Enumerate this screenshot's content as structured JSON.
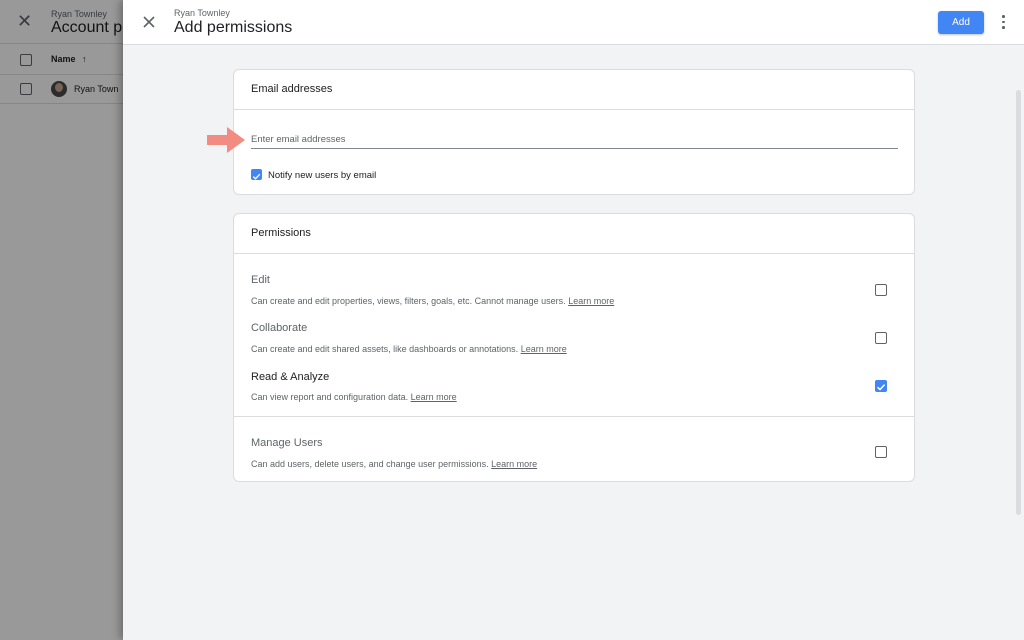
{
  "background_page": {
    "account_name": "Ryan Townley",
    "title": "Account p",
    "column_name": "Name",
    "sort_icon": "arrow-up-icon",
    "row_user": "Ryan Town"
  },
  "dialog": {
    "account_name": "Ryan Townley",
    "title": "Add permissions",
    "add_label": "Add",
    "colors": {
      "accent": "#4285f4",
      "panel_bg": "#f1f3f4",
      "arrow": "#f28b82"
    }
  },
  "email_card": {
    "title": "Email addresses",
    "input_placeholder": "Enter email addresses",
    "input_value": "",
    "notify_label": "Notify new users by email",
    "notify_checked": true
  },
  "permissions_card": {
    "title": "Permissions",
    "items": [
      {
        "title": "Edit",
        "description": "Can create and edit properties, views, filters, goals, etc. Cannot manage users.",
        "link": "Learn more",
        "checked": false
      },
      {
        "title": "Collaborate",
        "description": "Can create and edit shared assets, like dashboards or annotations.",
        "link": "Learn more",
        "checked": false
      },
      {
        "title": "Read & Analyze",
        "description": "Can view report and configuration data.",
        "link": "Learn more",
        "checked": true
      },
      {
        "title": "Manage Users",
        "description": "Can add users, delete users, and change user permissions.",
        "link": "Learn more",
        "checked": false
      }
    ]
  }
}
